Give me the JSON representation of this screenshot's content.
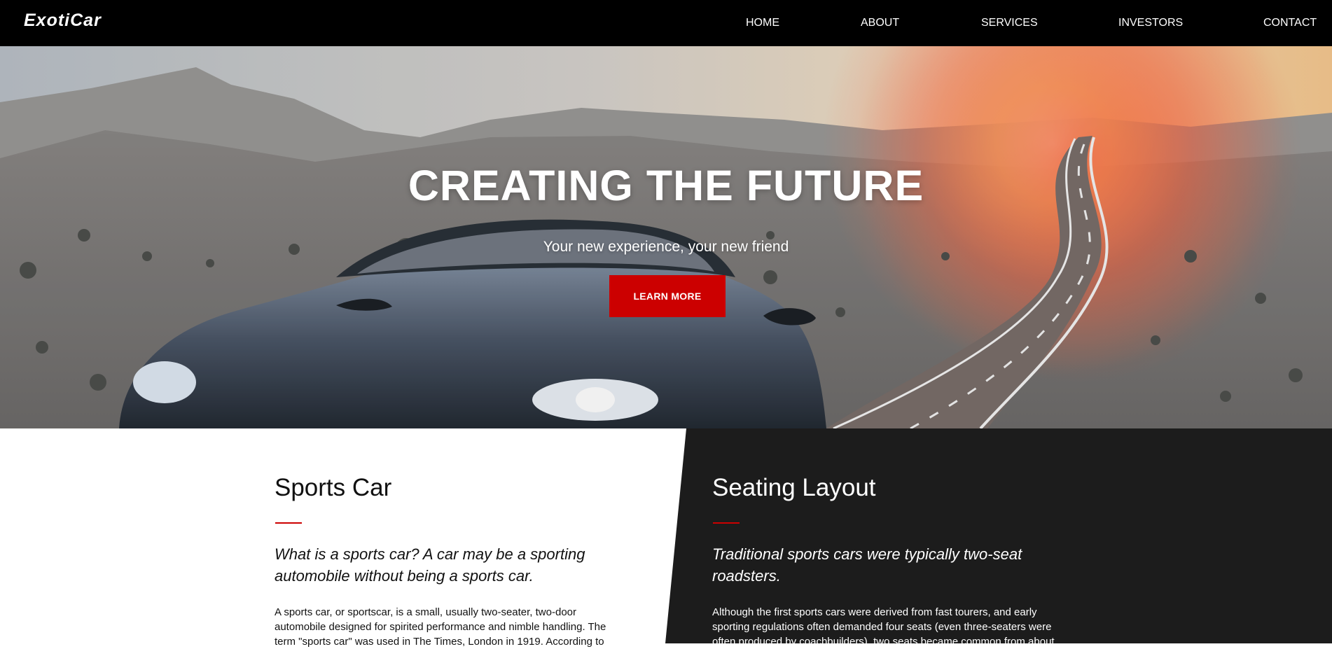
{
  "nav": {
    "logo": "ExotiCar",
    "links": [
      "HOME",
      "ABOUT",
      "SERVICES",
      "INVESTORS",
      "CONTACT"
    ]
  },
  "hero": {
    "title": "CREATING THE FUTURE",
    "subtitle": "Your new experience, your new friend",
    "button_label": "LEARN MORE"
  },
  "sections": [
    {
      "title": "Sports Car",
      "lead": "What is a sports car? A car may be a sporting automobile without being a sports car.",
      "body": "A sports car, or sportscar, is a small, usually two-seater, two-door automobile designed for spirited performance and nimble handling. The term \"sports car\" was used in The Times, London in 1919. According to"
    },
    {
      "title": "Seating Layout",
      "lead": "Traditional sports cars were typically two-seat roadsters.",
      "body": "Although the first sports cars were derived from fast tourers, and early sporting regulations often demanded four seats (even three-seaters were often produced by coachbuilders), two seats became common from about"
    }
  ],
  "colors": {
    "accent": "#cc0000",
    "nav_bg": "#000000",
    "dark_panel": "#1c1c1c"
  }
}
